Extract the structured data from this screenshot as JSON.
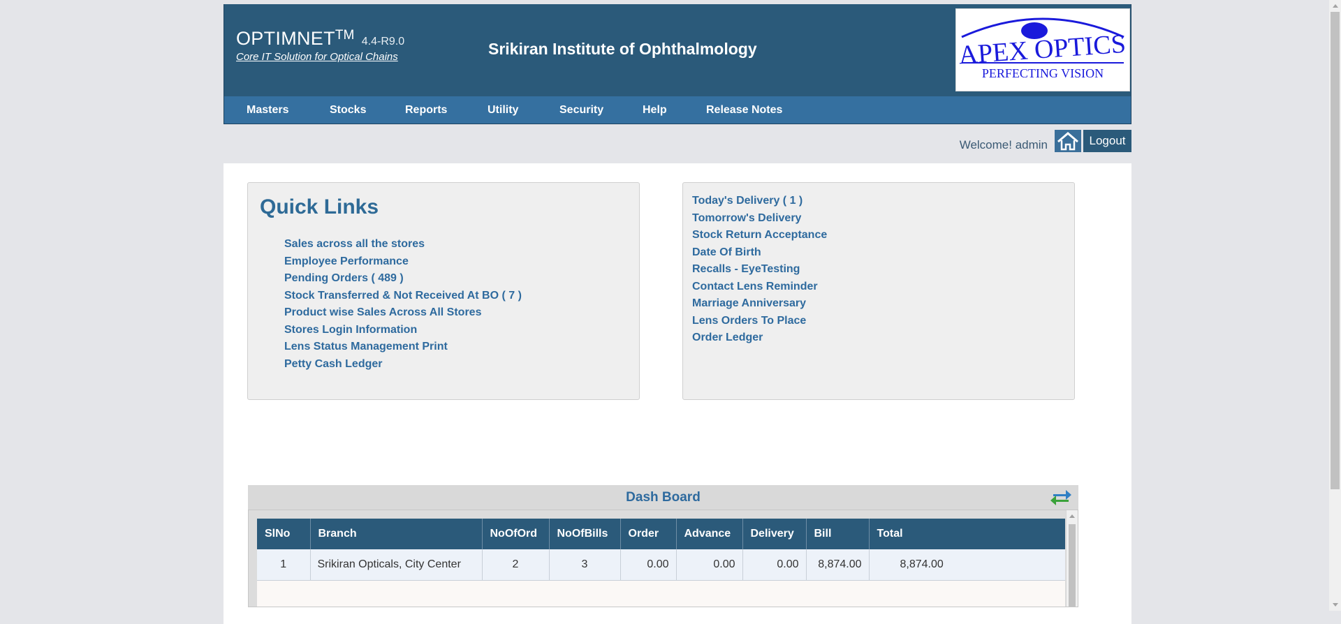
{
  "header": {
    "app_name": "OPTIMNET",
    "trademark": "TM",
    "version": "4.4-R9.0",
    "tagline": "Core IT Solution for Optical Chains",
    "organization": "Srikiran Institute of Ophthalmology",
    "logo": {
      "line1": "APEX OPTICS",
      "line2": "PERFECTING VISION"
    }
  },
  "nav": {
    "items": [
      {
        "label": "Masters"
      },
      {
        "label": "Stocks"
      },
      {
        "label": "Reports"
      },
      {
        "label": "Utility"
      },
      {
        "label": "Security"
      },
      {
        "label": "Help"
      },
      {
        "label": "Release Notes"
      }
    ]
  },
  "user_bar": {
    "welcome": "Welcome! admin",
    "home_icon": "home-icon",
    "logout_label": "Logout"
  },
  "quick_links": {
    "title": "Quick Links",
    "items": [
      "Sales across all the stores",
      "Employee Performance",
      "Pending Orders ( 489 )",
      "Stock Transferred & Not Received At BO ( 7 )",
      "Product wise Sales Across All Stores",
      "Stores Login Information",
      "Lens Status Management Print",
      "Petty Cash Ledger"
    ]
  },
  "reminders": {
    "items": [
      "Today's Delivery ( 1 )",
      "Tomorrow's Delivery",
      "Stock Return Acceptance",
      "Date Of Birth",
      "Recalls - EyeTesting",
      "Contact Lens Reminder",
      "Marriage Anniversary",
      "Lens Orders To Place",
      "Order Ledger"
    ]
  },
  "dashboard": {
    "title": "Dash Board",
    "refresh_icon": "refresh-icon",
    "columns": [
      "SlNo",
      "Branch",
      "NoOfOrd",
      "NoOfBills",
      "Order",
      "Advance",
      "Delivery",
      "Bill",
      "Total"
    ],
    "rows": [
      [
        "1",
        "Srikiran Opticals, City Center",
        "2",
        "3",
        "0.00",
        "0.00",
        "0.00",
        "8,874.00",
        "8,874.00"
      ]
    ]
  },
  "colors": {
    "header_bg": "#2b5a7a",
    "nav_bg": "#3570a0",
    "link": "#2e6a9e",
    "page_bg": "#e4e5e9"
  }
}
